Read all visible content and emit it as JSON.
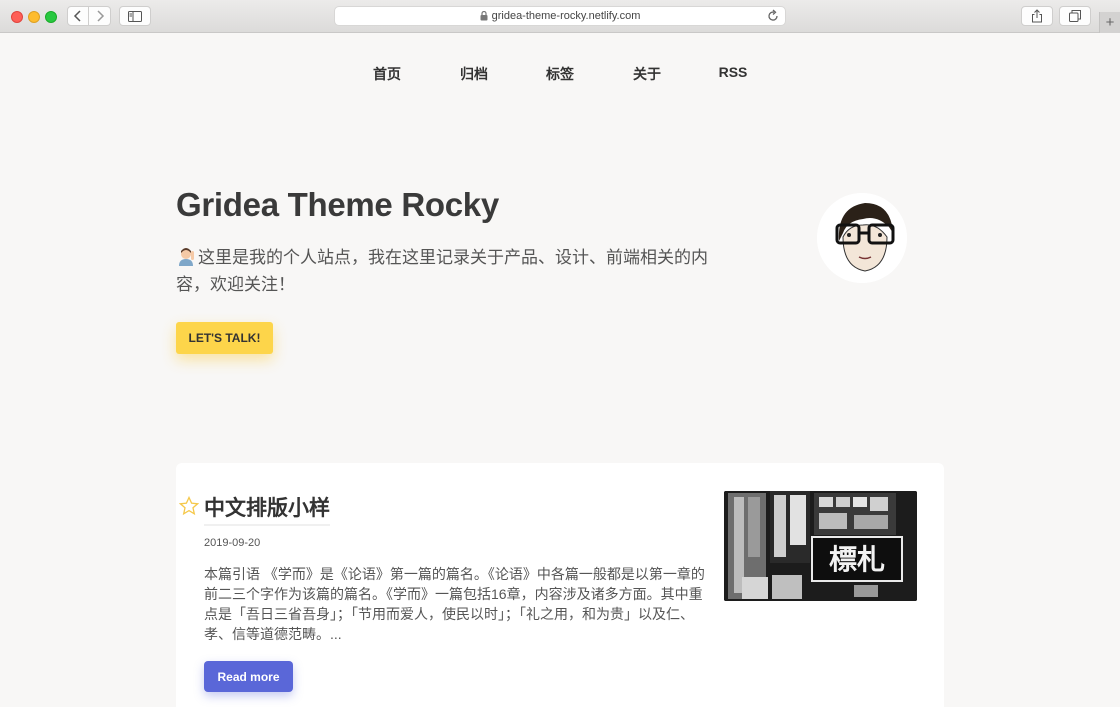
{
  "browser": {
    "url": "gridea-theme-rocky.netlify.com",
    "new_tab": "+"
  },
  "nav": {
    "items": [
      {
        "label": "首页"
      },
      {
        "label": "归档"
      },
      {
        "label": "标签"
      },
      {
        "label": "关于"
      },
      {
        "label": "RSS"
      }
    ]
  },
  "hero": {
    "title": "Gridea Theme Rocky",
    "description": "这里是我的个人站点，我在这里记录关于产品、设计、前端相关的内容，欢迎关注！",
    "cta_label": "LET'S TALK!"
  },
  "post": {
    "title": "中文排版小样",
    "date": "2019-09-20",
    "excerpt": "本篇引语 《学而》是《论语》第一篇的篇名。《论语》中各篇一般都是以第一章的前二三个字作为该篇的篇名。《学而》一篇包括16章，内容涉及诸多方面。其中重点是「吾日三省吾身」；「节用而爱人，使民以时」；「礼之用，和为贵」以及仁、孝、信等道德范畴。...",
    "read_more_label": "Read more",
    "thumbnail_text": "標札"
  },
  "colors": {
    "background": "#f8f7f6",
    "cta": "#fdd54a",
    "read_more": "#5a67d8",
    "card": "#ffffff"
  }
}
